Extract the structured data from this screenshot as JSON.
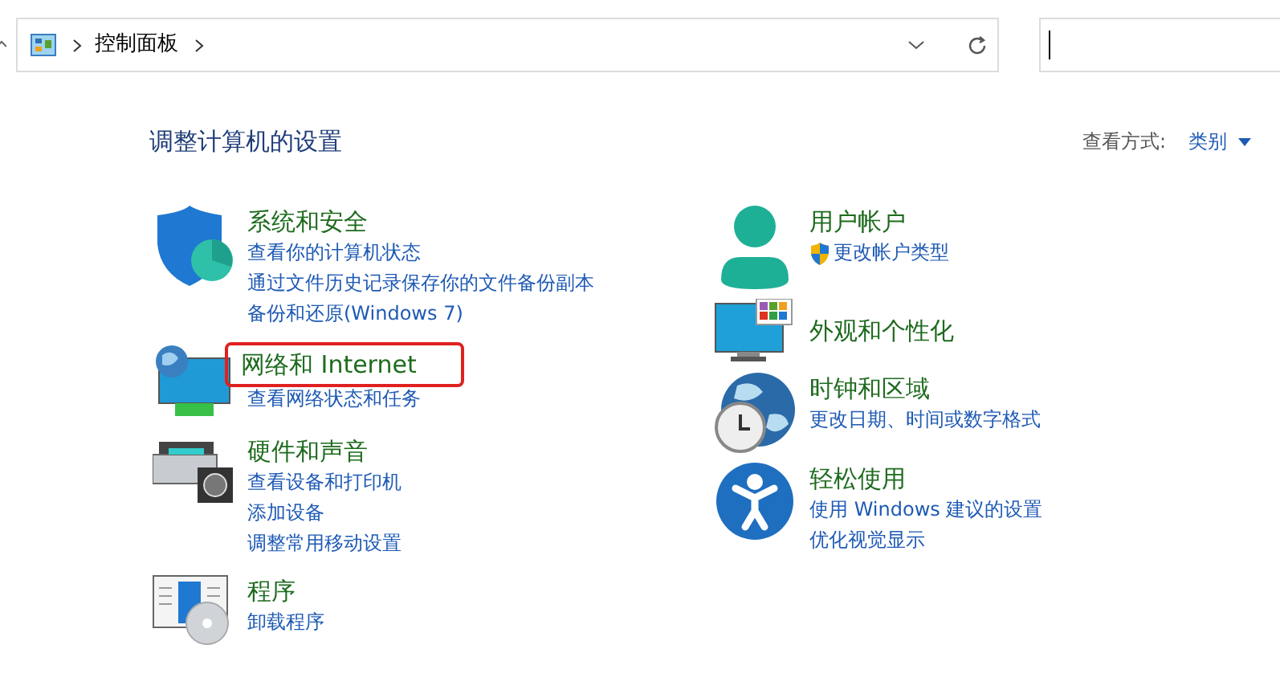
{
  "address_bar": {
    "path": [
      "控制面板"
    ]
  },
  "heading": "调整计算机的设置",
  "view_by": {
    "label": "查看方式:",
    "value": "类别"
  },
  "columns": [
    {
      "categories": [
        {
          "kind": "security",
          "title": "系统和安全",
          "highlighted": false,
          "links": [
            {
              "text": "查看你的计算机状态",
              "shield": false
            },
            {
              "text": "通过文件历史记录保存你的文件备份副本",
              "shield": false
            },
            {
              "text": "备份和还原(Windows 7)",
              "shield": false
            }
          ]
        },
        {
          "kind": "network",
          "title": "网络和 Internet",
          "highlighted": true,
          "links": [
            {
              "text": "查看网络状态和任务",
              "shield": false
            }
          ]
        },
        {
          "kind": "hardware",
          "title": "硬件和声音",
          "highlighted": false,
          "links": [
            {
              "text": "查看设备和打印机",
              "shield": false
            },
            {
              "text": "添加设备",
              "shield": false
            },
            {
              "text": "调整常用移动设置",
              "shield": false
            }
          ]
        },
        {
          "kind": "programs",
          "title": "程序",
          "highlighted": false,
          "links": [
            {
              "text": "卸载程序",
              "shield": false
            }
          ]
        }
      ]
    },
    {
      "categories": [
        {
          "kind": "accounts",
          "title": "用户帐户",
          "highlighted": false,
          "links": [
            {
              "text": "更改帐户类型",
              "shield": true
            }
          ]
        },
        {
          "kind": "appearance",
          "title": "外观和个性化",
          "highlighted": false
        },
        {
          "kind": "region",
          "title": "时钟和区域",
          "highlighted": false,
          "links": [
            {
              "text": "更改日期、时间或数字格式",
              "shield": false
            }
          ]
        },
        {
          "kind": "access",
          "title": "轻松使用",
          "highlighted": false,
          "links": [
            {
              "text": "使用 Windows 建议的设置",
              "shield": false
            },
            {
              "text": "优化视觉显示",
              "shield": false
            }
          ]
        }
      ]
    }
  ]
}
